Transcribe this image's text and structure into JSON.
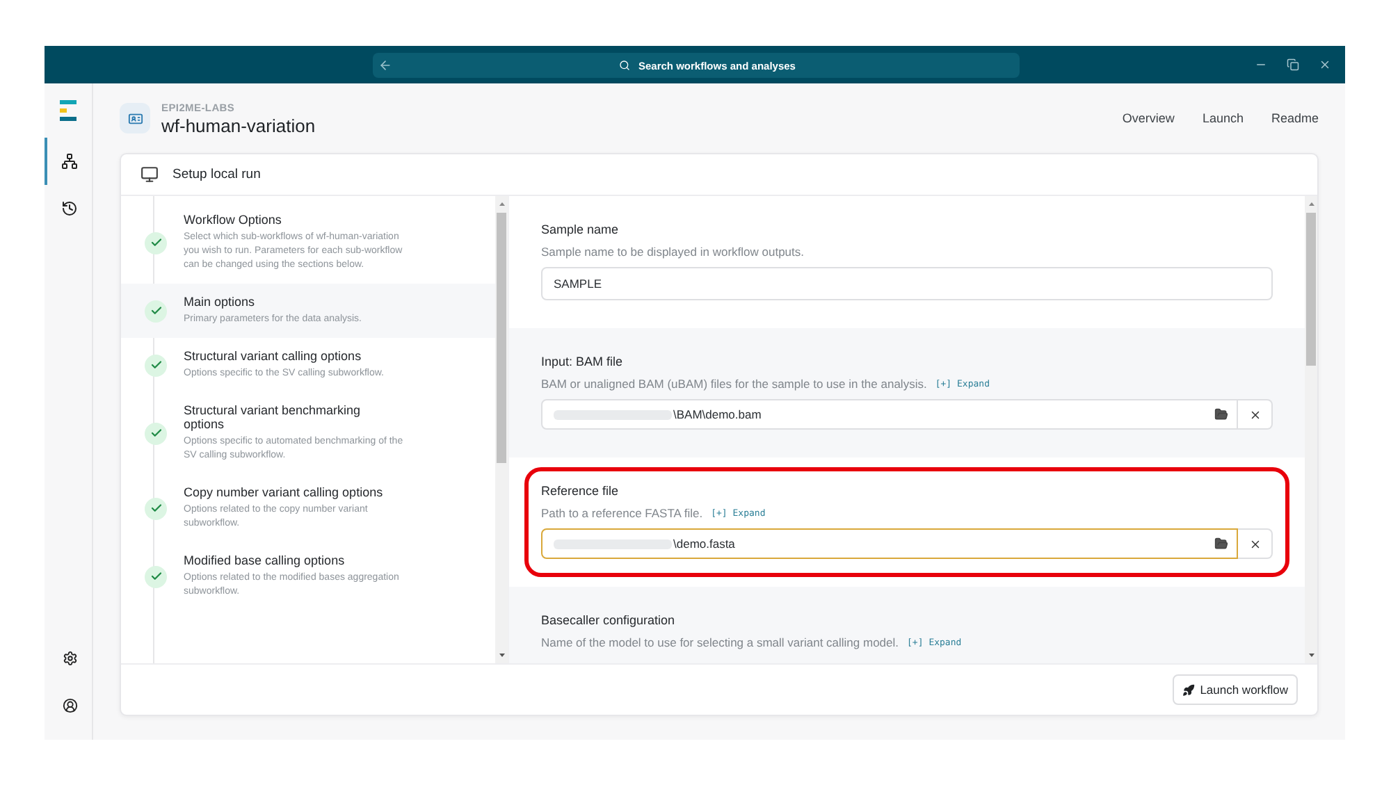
{
  "title_bar": {
    "search_placeholder": "Search workflows and analyses"
  },
  "rail": {
    "nav_items": [
      {
        "kind": "workflows",
        "selected": true
      },
      {
        "kind": "history",
        "selected": false
      }
    ],
    "bottom_items": [
      {
        "kind": "settings",
        "selected": false
      },
      {
        "kind": "account",
        "selected": false
      }
    ]
  },
  "workflow": {
    "org": "EPI2ME-LABS",
    "name": "wf-human-variation"
  },
  "nav_links": [
    "Overview",
    "Launch",
    "Readme"
  ],
  "card": {
    "title": "Setup local run"
  },
  "steps": [
    {
      "title": "Workflow Options",
      "description": "Select which sub-workflows of wf-human-variation you wish to run. Parameters for each sub-workflow can be changed using the sections below.",
      "done": true,
      "selected": false
    },
    {
      "title": "Main options",
      "description": "Primary parameters for the data analysis.",
      "done": true,
      "selected": true
    },
    {
      "title": "Structural variant calling options",
      "description": "Options specific to the SV calling subworkflow.",
      "done": true,
      "selected": false
    },
    {
      "title": "Structural variant benchmarking options",
      "description": "Options specific to automated benchmarking of the SV calling subworkflow.",
      "done": true,
      "selected": false
    },
    {
      "title": "Copy number variant calling options",
      "description": "Options related to the copy number variant subworkflow.",
      "done": true,
      "selected": false
    },
    {
      "title": "Modified base calling options",
      "description": "Options related to the modified bases aggregation subworkflow.",
      "done": true,
      "selected": false
    }
  ],
  "fields": [
    {
      "kind": "text",
      "label": "Sample name",
      "description": "Sample name to be displayed in workflow outputs.",
      "value": "SAMPLE",
      "highlighted": false
    },
    {
      "kind": "file",
      "label": "Input: BAM file",
      "description": "BAM or unaligned BAM (uBAM) files for the sample to use in the analysis.",
      "expand_mark": "[+]",
      "expand": "Expand",
      "value": "\\BAM\\demo.bam",
      "redacted": true,
      "focused": false,
      "highlighted": false
    },
    {
      "kind": "file",
      "label": "Reference file",
      "description": "Path to a reference FASTA file.",
      "expand_mark": "[+]",
      "expand": "Expand",
      "value": "\\demo.fasta",
      "redacted": true,
      "focused": true,
      "highlighted": true
    },
    {
      "label": "Basecaller configuration",
      "description": "Name of the model to use for selecting a small variant calling model.",
      "expand_mark": "[+]",
      "expand": "Expand",
      "highlighted": false
    }
  ],
  "launch_button": "Launch workflow"
}
